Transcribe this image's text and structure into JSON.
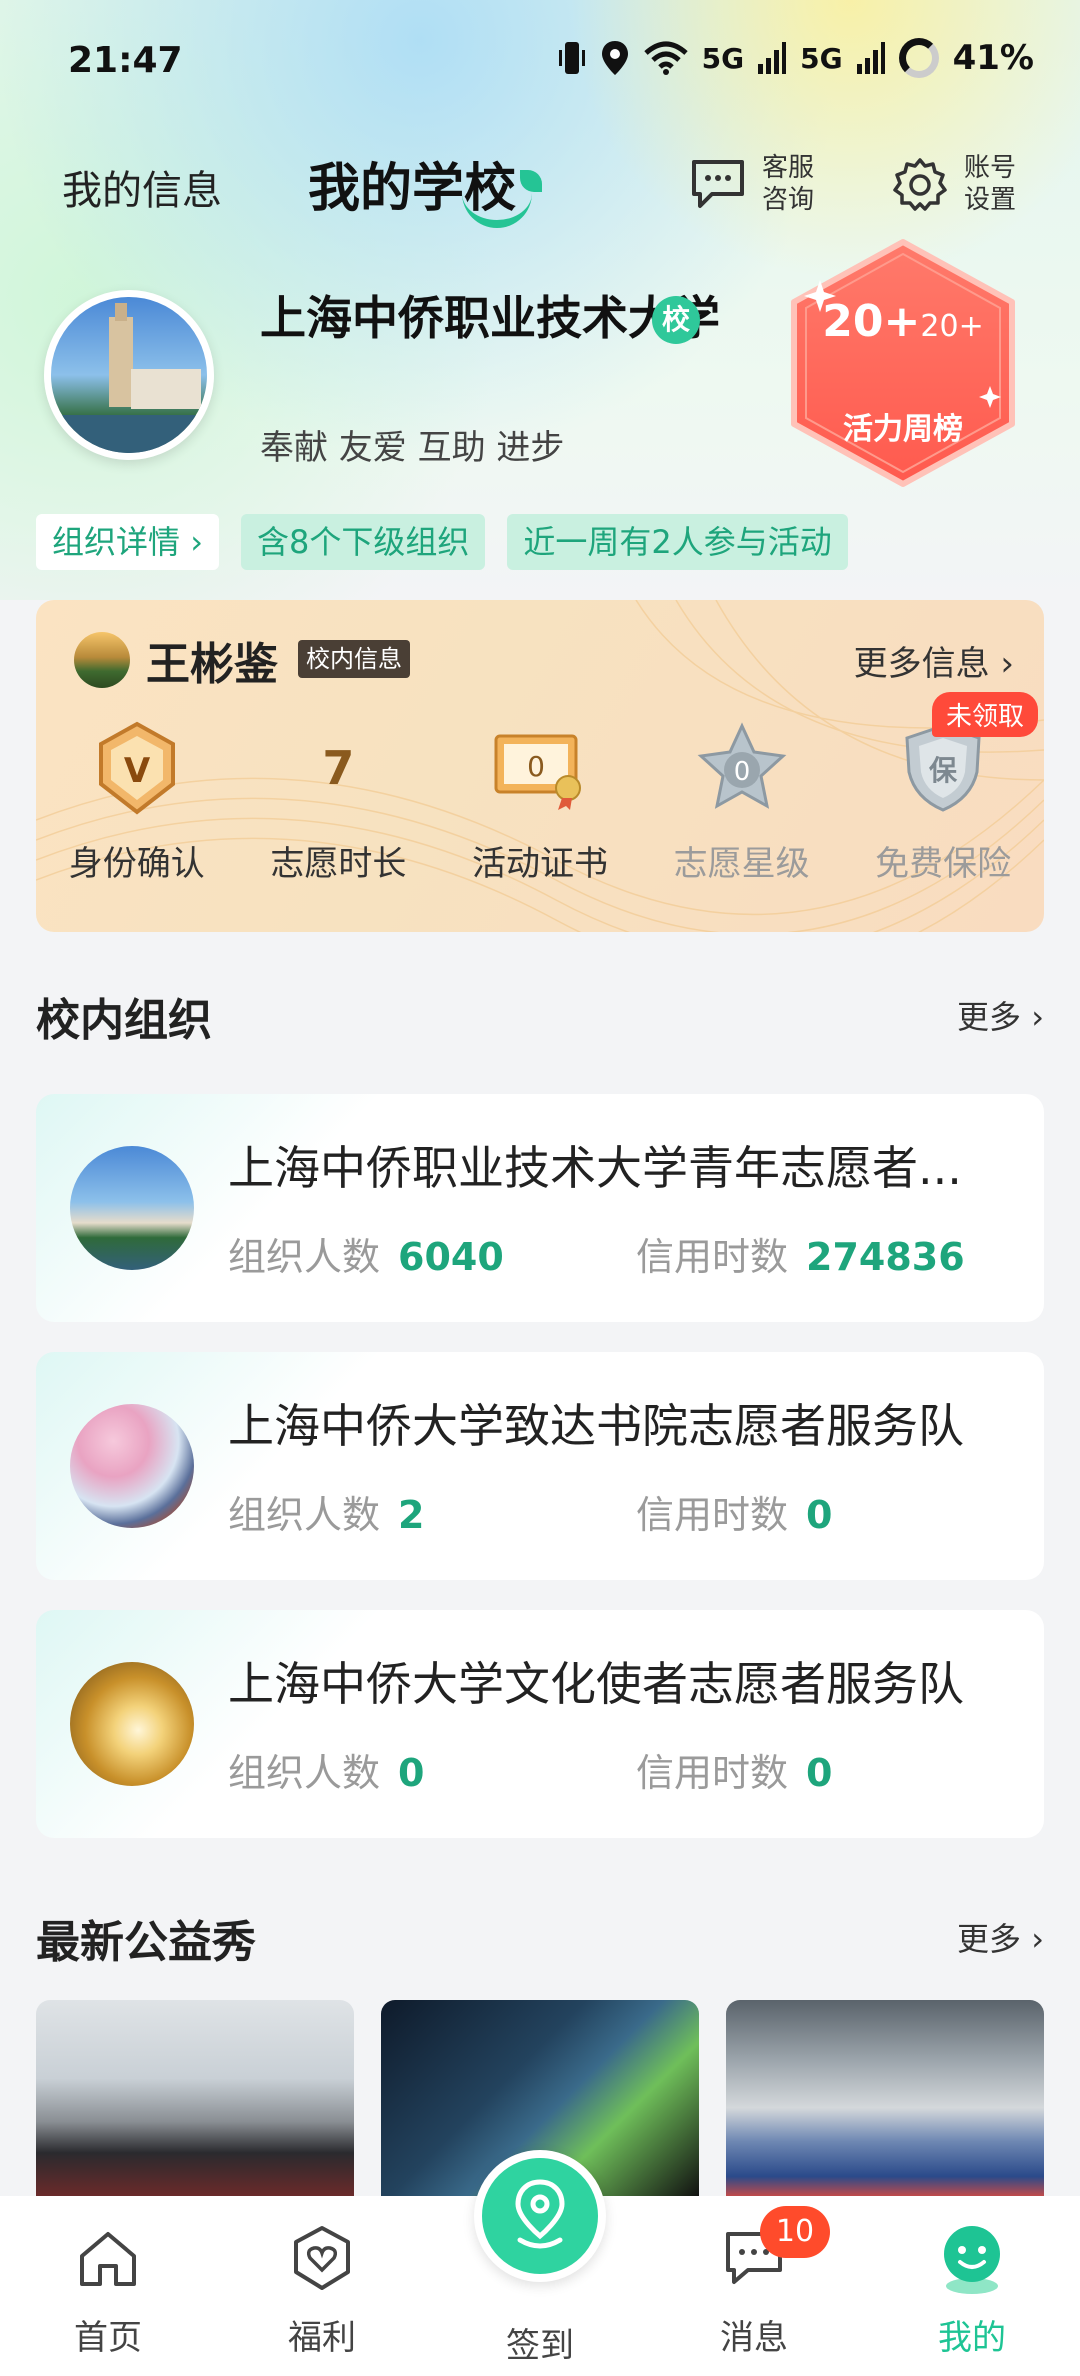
{
  "status_bar": {
    "time": "21:47",
    "signal_label_1": "5G",
    "signal_label_2": "5G",
    "battery": "41%"
  },
  "header": {
    "tab_info": "我的信息",
    "tab_school": "我的学校",
    "service_label_line1": "客服",
    "service_label_line2": "咨询",
    "settings_label_line1": "账号",
    "settings_label_line2": "设置"
  },
  "school": {
    "name": "上海中侨职业技术大学",
    "badge": "校",
    "motto": "奉献 友爱 互助 进步",
    "vitality_value": "20+",
    "vitality_sub": "20+",
    "vitality_label": "活力周榜"
  },
  "tags": [
    "组织详情",
    "含8个下级组织",
    "近一周有2人参与活动"
  ],
  "user_card": {
    "name": "王彬鉴",
    "badge": "校内信息",
    "more": "更多信息",
    "stats": [
      {
        "label": "身份确认",
        "value": "V"
      },
      {
        "label": "志愿时长",
        "value": "7"
      },
      {
        "label": "活动证书",
        "value": "0"
      },
      {
        "label": "志愿星级",
        "value": "0"
      },
      {
        "label": "免费保险",
        "value": "保",
        "flag": "未领取"
      }
    ]
  },
  "orgs_section": {
    "title": "校内组织",
    "more": "更多"
  },
  "orgs": [
    {
      "name": "上海中侨职业技术大学青年志愿者...",
      "members_label": "组织人数",
      "members": "6040",
      "credit_label": "信用时数",
      "credit": "274836"
    },
    {
      "name": "上海中侨大学致达书院志愿者服务队",
      "members_label": "组织人数",
      "members": "2",
      "credit_label": "信用时数",
      "credit": "0"
    },
    {
      "name": "上海中侨大学文化使者志愿者服务队",
      "members_label": "组织人数",
      "members": "0",
      "credit_label": "信用时数",
      "credit": "0"
    }
  ],
  "show_section": {
    "title": "最新公益秀",
    "more": "更多"
  },
  "bottom_nav": {
    "home": "首页",
    "welfare": "福利",
    "checkin": "签到",
    "messages": "消息",
    "messages_badge": "10",
    "mine": "我的"
  },
  "colors": {
    "accent": "#1ec494",
    "text_green": "#1ea57c",
    "badge_red": "#ff4a3a"
  },
  "icons": [
    "vibrate-icon",
    "location-icon",
    "wifi-icon",
    "signal-icon",
    "battery-icon",
    "chat-service-icon",
    "gear-icon",
    "vip-medal-icon",
    "certificate-icon",
    "star-badge-icon",
    "insurance-shield-icon",
    "home-icon",
    "heart-shield-icon",
    "location-pin-icon",
    "message-icon",
    "mine-face-icon"
  ]
}
